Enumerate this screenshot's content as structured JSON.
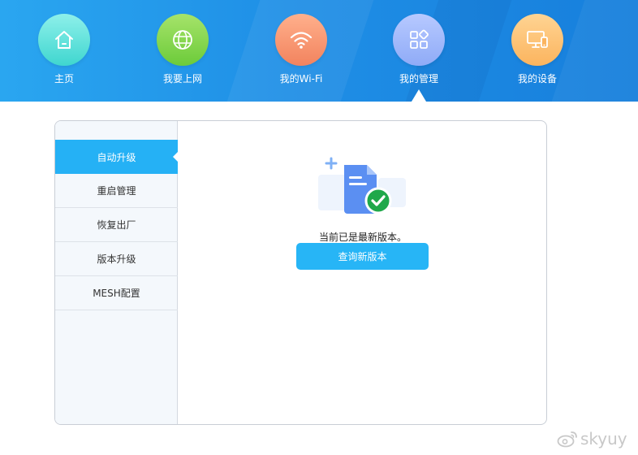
{
  "nav": {
    "items": [
      {
        "label": "主页",
        "icon": "home-icon",
        "color_top": "#8ef0ea",
        "color_bottom": "#3fd6cf"
      },
      {
        "label": "我要上网",
        "icon": "globe-icon",
        "color_top": "#a6e36a",
        "color_bottom": "#6ccb3a"
      },
      {
        "label": "我的Wi-Fi",
        "icon": "wifi-icon",
        "color_top": "#ffb08c",
        "color_bottom": "#f2835e"
      },
      {
        "label": "我的管理",
        "icon": "apps-icon",
        "color_top": "#b7c9ff",
        "color_bottom": "#8fabf7"
      },
      {
        "label": "我的设备",
        "icon": "devices-icon",
        "color_top": "#ffd493",
        "color_bottom": "#fbb45e"
      }
    ],
    "active_index": 3
  },
  "sidebar": {
    "items": [
      {
        "label": "自动升级",
        "active": true
      },
      {
        "label": "重启管理",
        "active": false
      },
      {
        "label": "恢复出厂",
        "active": false
      },
      {
        "label": "版本升级",
        "active": false
      },
      {
        "label": "MESH配置",
        "active": false
      }
    ]
  },
  "content": {
    "status_text": "当前已是最新版本。",
    "check_button_label": "查询新版本"
  },
  "watermark": {
    "text": "skyuy"
  },
  "colors": {
    "accent": "#25b1f5",
    "success": "#1fa84a"
  }
}
